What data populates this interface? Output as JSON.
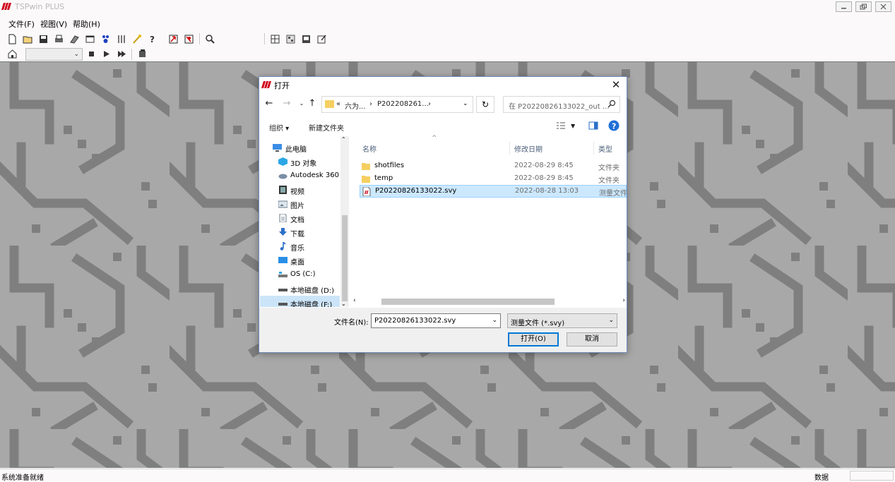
{
  "app": {
    "title": "TSPwin PLUS",
    "menu": [
      "文件(F)",
      "视图(V)",
      "帮助(H)"
    ]
  },
  "statusbar": {
    "left": "系统准备就绪",
    "right": "数据"
  },
  "dialog": {
    "title": "打开",
    "address": {
      "prefix": "«",
      "seg1": "六为...",
      "sep": "›",
      "seg2": "P202208261...",
      "sep2": "›"
    },
    "search_placeholder": "在 P20220826133022_out ...",
    "organize": "组织 ▾",
    "new_folder": "新建文件夹",
    "nav_items": [
      {
        "label": "此电脑",
        "icon": "pc-icon"
      },
      {
        "label": "3D 对象",
        "icon": "3d-objects-icon"
      },
      {
        "label": "Autodesk 360",
        "icon": "cloud-icon"
      },
      {
        "label": "视频",
        "icon": "video-icon"
      },
      {
        "label": "图片",
        "icon": "picture-icon"
      },
      {
        "label": "文档",
        "icon": "document-icon"
      },
      {
        "label": "下载",
        "icon": "download-icon"
      },
      {
        "label": "音乐",
        "icon": "music-icon"
      },
      {
        "label": "桌面",
        "icon": "desktop-icon"
      },
      {
        "label": "OS (C:)",
        "icon": "drive-icon"
      },
      {
        "label": "本地磁盘 (D:)",
        "icon": "drive-icon"
      },
      {
        "label": "本地磁盘 (F:)",
        "icon": "drive-icon"
      }
    ],
    "columns": {
      "name": "名称",
      "date": "修改日期",
      "type": "类型"
    },
    "files": [
      {
        "name": "shotfiles",
        "date": "2022-08-29 8:45",
        "type": "文件夹",
        "kind": "folder"
      },
      {
        "name": "temp",
        "date": "2022-08-29 8:45",
        "type": "文件夹",
        "kind": "folder"
      },
      {
        "name": "P20220826133022.svy",
        "date": "2022-08-28 13:03",
        "type": "测量文件",
        "kind": "file"
      }
    ],
    "filename_label": "文件名(N):",
    "filename_value": "P20220826133022.svy",
    "filetype_value": "测量文件 (*.svy)",
    "open_label": "打开(O)",
    "cancel_label": "取消"
  },
  "colors": {
    "workspace_bg": "#a8a8a8",
    "pattern": "#7f7f7f",
    "selection": "#cce8ff",
    "accent": "#0078d7"
  }
}
